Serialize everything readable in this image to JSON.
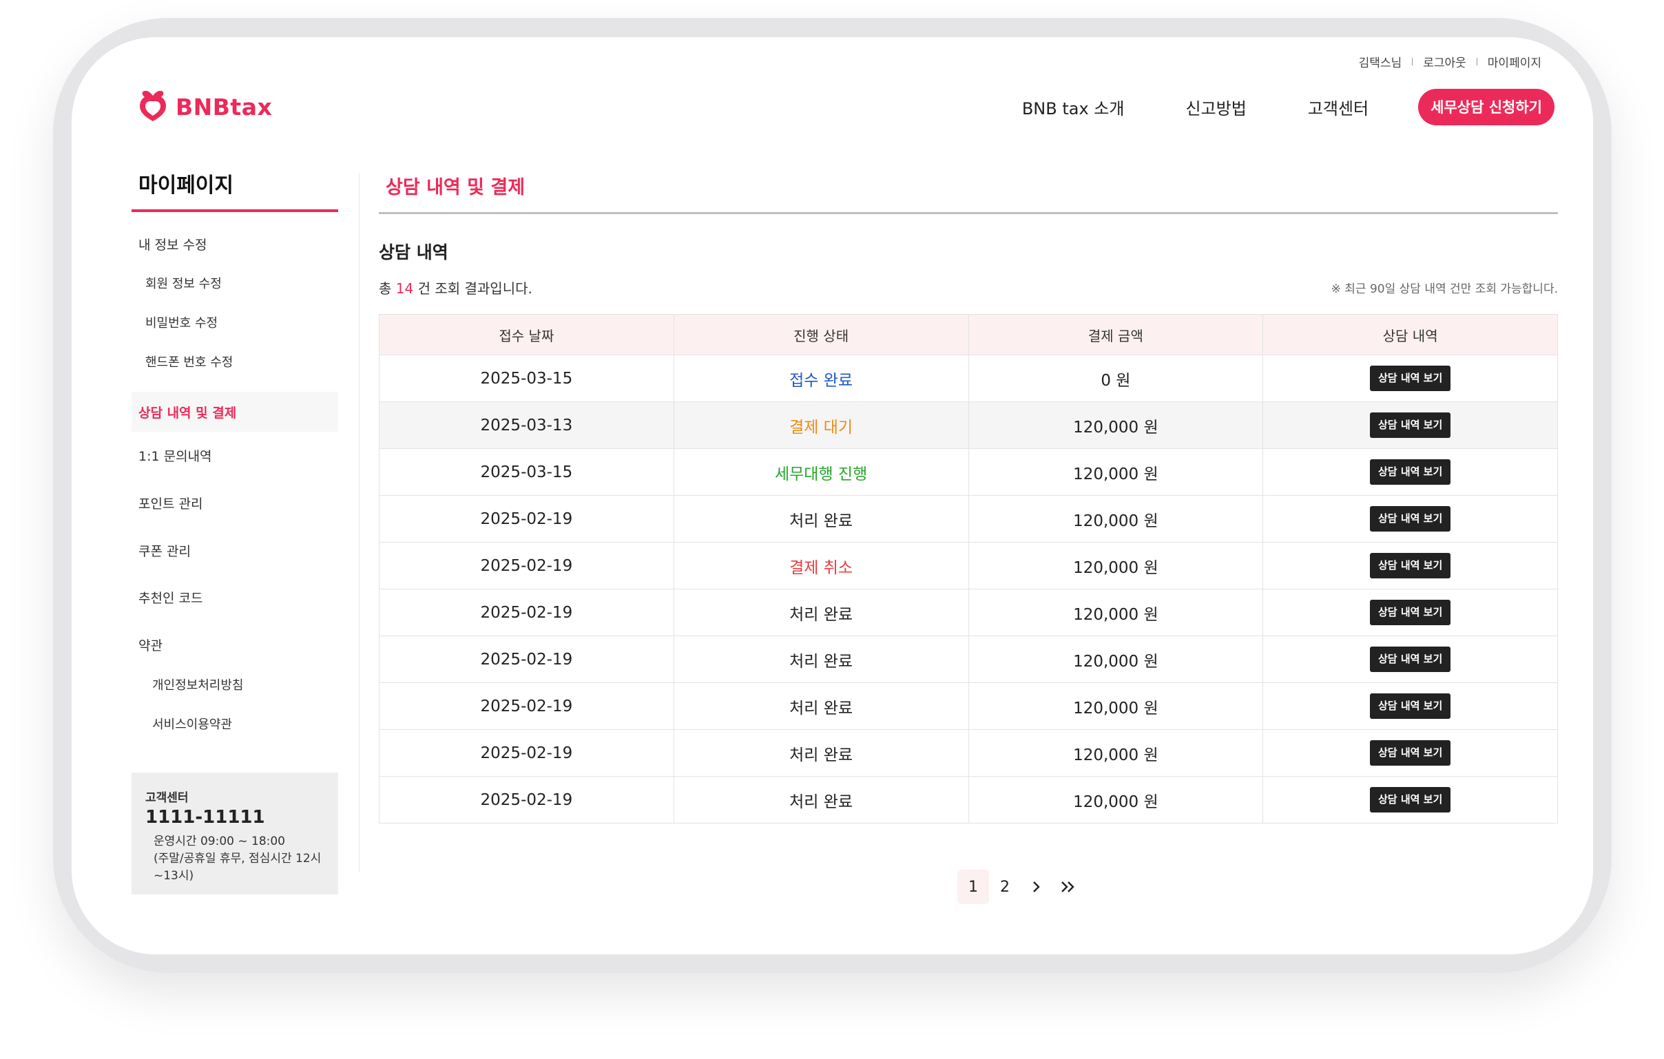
{
  "header": {
    "logo_text": "BNBtax",
    "user_links": [
      "김택스님",
      "로그아웃",
      "마이페이지"
    ],
    "nav": [
      "BNB tax 소개",
      "신고방법",
      "고객센터"
    ],
    "cta": "세무상담 신청하기"
  },
  "sidebar": {
    "title": "마이페이지",
    "items": [
      {
        "label": "내 정보 수정"
      },
      {
        "label": "회원 정보 수정"
      },
      {
        "label": "비밀번호 수정"
      },
      {
        "label": "핸드폰 번호 수정"
      },
      {
        "label": "상담 내역 및 결제"
      },
      {
        "label": "1:1 문의내역"
      },
      {
        "label": "포인트 관리"
      },
      {
        "label": "쿠폰 관리"
      },
      {
        "label": "추천인 코드"
      },
      {
        "label": "약관"
      },
      {
        "label": "개인정보처리방침"
      },
      {
        "label": "서비스이용약관"
      }
    ],
    "support": {
      "label": "고객센터",
      "phone": "1111-11111",
      "hours": "운영시간 09:00 ~ 18:00",
      "hours_note": "(주말/공휴일 휴무, 점심시간 12시 ~13시)"
    }
  },
  "main": {
    "title": "상담 내역 및 결제",
    "section_title": "상담 내역",
    "count_prefix": "총",
    "count": "14",
    "count_suffix": "건 조회 결과입니다.",
    "notice": "※ 최근 90일 상담 내역 건만 조회 가능합니다.",
    "columns": [
      "접수 날짜",
      "진행 상태",
      "결제 금액",
      "상담 내역"
    ],
    "rows": [
      {
        "date": "2025-03-15",
        "status": "접수 완료",
        "status_color": "#1f57c9",
        "amount": "0 원",
        "action": "상담 내역 보기"
      },
      {
        "date": "2025-03-13",
        "status": "결제 대기",
        "status_color": "#f08a12",
        "amount": "120,000 원",
        "action": "상담 내역 보기"
      },
      {
        "date": "2025-03-15",
        "status": "세무대행 진행",
        "status_color": "#25a62a",
        "amount": "120,000 원",
        "action": "상담 내역 보기"
      },
      {
        "date": "2025-02-19",
        "status": "처리 완료",
        "status_color": "#222222",
        "amount": "120,000 원",
        "action": "상담 내역 보기"
      },
      {
        "date": "2025-02-19",
        "status": "결제 취소",
        "status_color": "#ec3a3a",
        "amount": "120,000 원",
        "action": "상담 내역 보기"
      },
      {
        "date": "2025-02-19",
        "status": "처리 완료",
        "status_color": "#222222",
        "amount": "120,000 원",
        "action": "상담 내역 보기"
      },
      {
        "date": "2025-02-19",
        "status": "처리 완료",
        "status_color": "#222222",
        "amount": "120,000 원",
        "action": "상담 내역 보기"
      },
      {
        "date": "2025-02-19",
        "status": "처리 완료",
        "status_color": "#222222",
        "amount": "120,000 원",
        "action": "상담 내역 보기"
      },
      {
        "date": "2025-02-19",
        "status": "처리 완료",
        "status_color": "#222222",
        "amount": "120,000 원",
        "action": "상담 내역 보기"
      },
      {
        "date": "2025-02-19",
        "status": "처리 완료",
        "status_color": "#222222",
        "amount": "120,000 원",
        "action": "상담 내역 보기"
      }
    ],
    "pagination": {
      "pages": [
        "1",
        "2"
      ],
      "current": "1",
      "next_icon": "chevron-right-icon",
      "last_icon": "double-chevron-right-icon"
    }
  },
  "colors": {
    "accent": "#ec2a59",
    "header_bg": "#fdf0f0",
    "button_dark": "#222222"
  }
}
